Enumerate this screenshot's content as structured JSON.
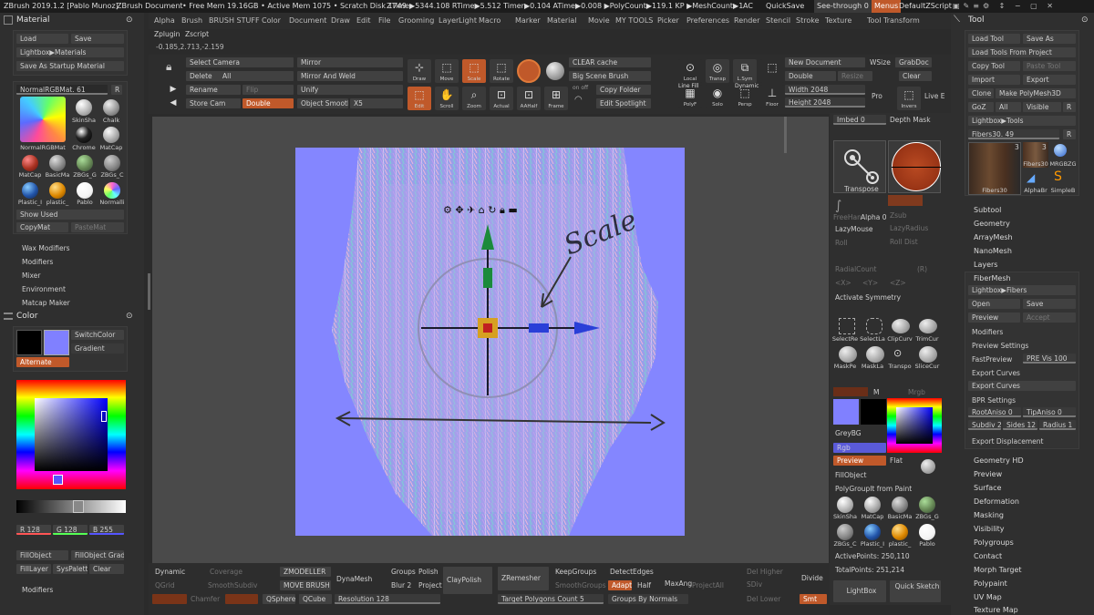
{
  "titlebar": {
    "app": "ZBrush 2019.1.2 [Pablo Munoz]",
    "doc": "ZBrush Document",
    "stats": "• Free Mem 19.16GB • Active Mem 1075 • Scratch Disk 1749 •",
    "timers": "ZTime▶5344.108 RTime▶5.512 Timer▶0.104 ATime▶0.008 ▶PolyCount▶119.1 KP ▶MeshCount▶1",
    "ac": "AC",
    "quicksave": "QuickSave",
    "seethrough": "See-through 0",
    "menus": "Menus",
    "script": "DefaultZScript"
  },
  "menus": [
    "Alpha",
    "Brush",
    "BRUSH STUFF",
    "Color",
    "Document",
    "Draw",
    "Edit",
    "File",
    "Grooming",
    "Layer",
    "Light",
    "Macro",
    "Marker",
    "Material",
    "Movie",
    "MY TOOLS",
    "Picker",
    "Preferences",
    "Render",
    "Stencil",
    "Stroke",
    "Texture",
    "Tool",
    "Transform"
  ],
  "submenu": [
    "Zplugin",
    "Zscript"
  ],
  "coords": "-0.185,2.713,-2.159",
  "left": {
    "material_title": "Material",
    "load": "Load",
    "save": "Save",
    "lightbox_materials": "Lightbox▶Materials",
    "save_startup": "Save As Startup Material",
    "current_mat": "NormalRGBMat. 61",
    "r": "R",
    "mats": [
      "SkinSha",
      "Chalk",
      "NormalRGBMat",
      "Chrome",
      "MatCap",
      "MatCap",
      "BasicMa",
      "ZBGs_G",
      "ZBGs_C",
      "Plastic_I",
      "plastic_",
      "Pablo",
      "Normalli"
    ],
    "show_used": "Show Used",
    "copymat": "CopyMat",
    "pastemat": "PasteMat",
    "sections": [
      "Wax Modifiers",
      "Modifiers",
      "Mixer",
      "Environment",
      "Matcap Maker"
    ],
    "color_title": "Color",
    "switchcolor": "SwitchColor",
    "gradient": "Gradient",
    "alternate": "Alternate",
    "r_val": "R 128",
    "g_val": "G 128",
    "b_val": "B 255",
    "fillobject": "FillObject",
    "fillobject_grad": "FillObject Grad",
    "filllayer": "FillLayer",
    "syspalette": "SysPalette",
    "clear": "Clear",
    "modifiers": "Modifiers"
  },
  "toolbar": {
    "select_camera": "Select Camera",
    "mirror": "Mirror",
    "delete": "Delete",
    "all": "All",
    "mirror_weld": "Mirror And Weld",
    "rename": "Rename",
    "flip": "Flip",
    "unify": "Unify",
    "store_cam": "Store Cam",
    "double": "Double",
    "object_smooth": "Object Smooth",
    "x5": "X5",
    "icons": [
      {
        "label": "Draw",
        "icon": "draw-icon"
      },
      {
        "label": "Move",
        "icon": "move-icon"
      },
      {
        "label": "Scale",
        "icon": "scale-icon"
      },
      {
        "label": "Rotate",
        "icon": "rotate-icon"
      },
      {
        "label": "Edit",
        "icon": "edit-icon"
      },
      {
        "label": "Scroll",
        "icon": "scroll-icon"
      },
      {
        "label": "Zoom",
        "icon": "zoom-icon"
      },
      {
        "label": "Actual",
        "icon": "actual-icon"
      },
      {
        "label": "AAHalf",
        "icon": "aahalf-icon"
      },
      {
        "label": "Frame",
        "icon": "frame-icon"
      }
    ],
    "clear_cache": "CLEAR cache",
    "big_scene_brush": "Big Scene Brush",
    "copy_folder": "Copy Folder",
    "edit_spotlight": "Edit Spotlight",
    "on_off": "on off",
    "right_icons": [
      "Local",
      "Transp",
      "L.Sym",
      "Floor",
      "Solo",
      "Persp",
      "PolyF",
      "Dynamic",
      "Line Fill"
    ],
    "new_document": "New Document",
    "wsize": "WSize",
    "grabdoc": "GrabDoc",
    "double2": "Double",
    "resize": "Resize",
    "clear": "Clear",
    "width": "Width 2048",
    "height": "Height 2048",
    "pro": "Pro",
    "invers": "Invers",
    "live_e": "Live E"
  },
  "canvas": {
    "bg": "#8486ff",
    "annotation": "Scale"
  },
  "midright": {
    "imbed": "Imbed 0",
    "depth_mask": "Depth Mask",
    "transpose": "Transpose",
    "alpha": "Alpha 0",
    "freehand": "FreeHan",
    "zsub": "Zsub",
    "lazymouse": "LazyMouse",
    "lazyradius": "LazyRadius",
    "roll": "Roll",
    "rolldist": "Roll Dist",
    "radialcount": "RadialCount",
    "r": "(R)",
    "xyz": [
      "<X>",
      "<Y>",
      "<Z>"
    ],
    "activate_symmetry": "Activate Symmetry",
    "select_tools": [
      "SelectRe",
      "SelectLa",
      "ClipCurv",
      "TrimCur",
      "MaskPe",
      "MaskLa",
      "Transpo",
      "SliceCur"
    ],
    "m": "M",
    "mrgb": "Mrgb",
    "greybg": "GreyBG",
    "rgb": "Rgb",
    "preview": "Preview",
    "flat": "Flat",
    "fillobject": "FillObject",
    "polygroupit": "PolyGroupIt from Paint",
    "mats": [
      "SkinSha",
      "MatCap",
      "BasicMa",
      "ZBGs_G",
      "ZBGs_C",
      "Plastic_I",
      "plastic_",
      "Pablo"
    ],
    "active_points": "ActivePoints: 250,110",
    "total_points": "TotalPoints: 251,214"
  },
  "bottom": {
    "dynamic": "Dynamic",
    "coverage": "Coverage",
    "zmodeller": "ZMODELLER",
    "groups": "Groups",
    "polish": "Polish",
    "qgrid": "QGrid",
    "smoothsubdiv": "SmoothSubdiv",
    "move_brush": "MOVE BRUSH",
    "dynamesh": "DynaMesh",
    "blur": "Blur 2",
    "project": "Project",
    "claypolish": "ClayPolish",
    "zremesher": "ZRemesher",
    "keepgroups": "KeepGroups",
    "detectedges": "DetectEdges",
    "smoothgroups": "SmoothGroups",
    "adapt": "Adapt",
    "half": "Half",
    "maxangle": "MaxAng",
    "projectall": "ProjectAll",
    "del_higher": "Del Higher",
    "divide": "Divide",
    "sdiv": "SDiv",
    "del_lower": "Del Lower",
    "chamfer": "Chamfer",
    "qsphere": "QSphere",
    "qcube": "QCube",
    "resolution": "Resolution 128",
    "target_poly": "Target Polygons Count 5",
    "groups_normals": "Groups By Normals",
    "smt": "Smt",
    "lightbox": "LightBox",
    "quick_sketch": "Quick Sketch"
  },
  "tool": {
    "title": "Tool",
    "load_tool": "Load Tool",
    "save_as": "Save As",
    "load_from_project": "Load Tools From Project",
    "copy_tool": "Copy Tool",
    "paste_tool": "Paste Tool",
    "import": "Import",
    "export": "Export",
    "clone": "Clone",
    "make_polymesh": "Make PolyMesh3D",
    "goz": "GoZ",
    "all": "All",
    "visible": "Visible",
    "r": "R",
    "lightbox_tools": "Lightbox▶Tools",
    "fibers": "Fibers30. 49",
    "r2": "R",
    "thumbs": [
      "Fibers30",
      "Fibers30",
      "MRGBZG",
      "AlphaBr",
      "SimpleB"
    ],
    "count": "3",
    "count2": "3",
    "subtool": "Subtool",
    "geometry": "Geometry",
    "arraymesh": "ArrayMesh",
    "nanomesh": "NanoMesh",
    "layers": "Layers",
    "fibermesh": "FiberMesh",
    "lightbox_fibers": "Lightbox▶Fibers",
    "open": "Open",
    "save": "Save",
    "preview": "Preview",
    "accept": "Accept",
    "modifiers": "Modifiers",
    "preview_settings": "Preview Settings",
    "fastpreview": "FastPreview",
    "pre_vis": "PRE Vis 100",
    "export_curves_hdr": "Export Curves",
    "export_curves_btn": "Export Curves",
    "bpr_settings": "BPR Settings",
    "rootaniso": "RootAniso 0",
    "tipaniso": "TipAniso 0",
    "subdiv": "Subdiv 2",
    "sides": "Sides 12",
    "radius": "Radius 1",
    "export_displacement": "Export Displacement",
    "sections": [
      "Geometry HD",
      "Preview",
      "Surface",
      "Deformation",
      "Masking",
      "Visibility",
      "Polygroups",
      "Contact",
      "Morph Target",
      "Polypaint",
      "UV Map",
      "Texture Map"
    ]
  }
}
